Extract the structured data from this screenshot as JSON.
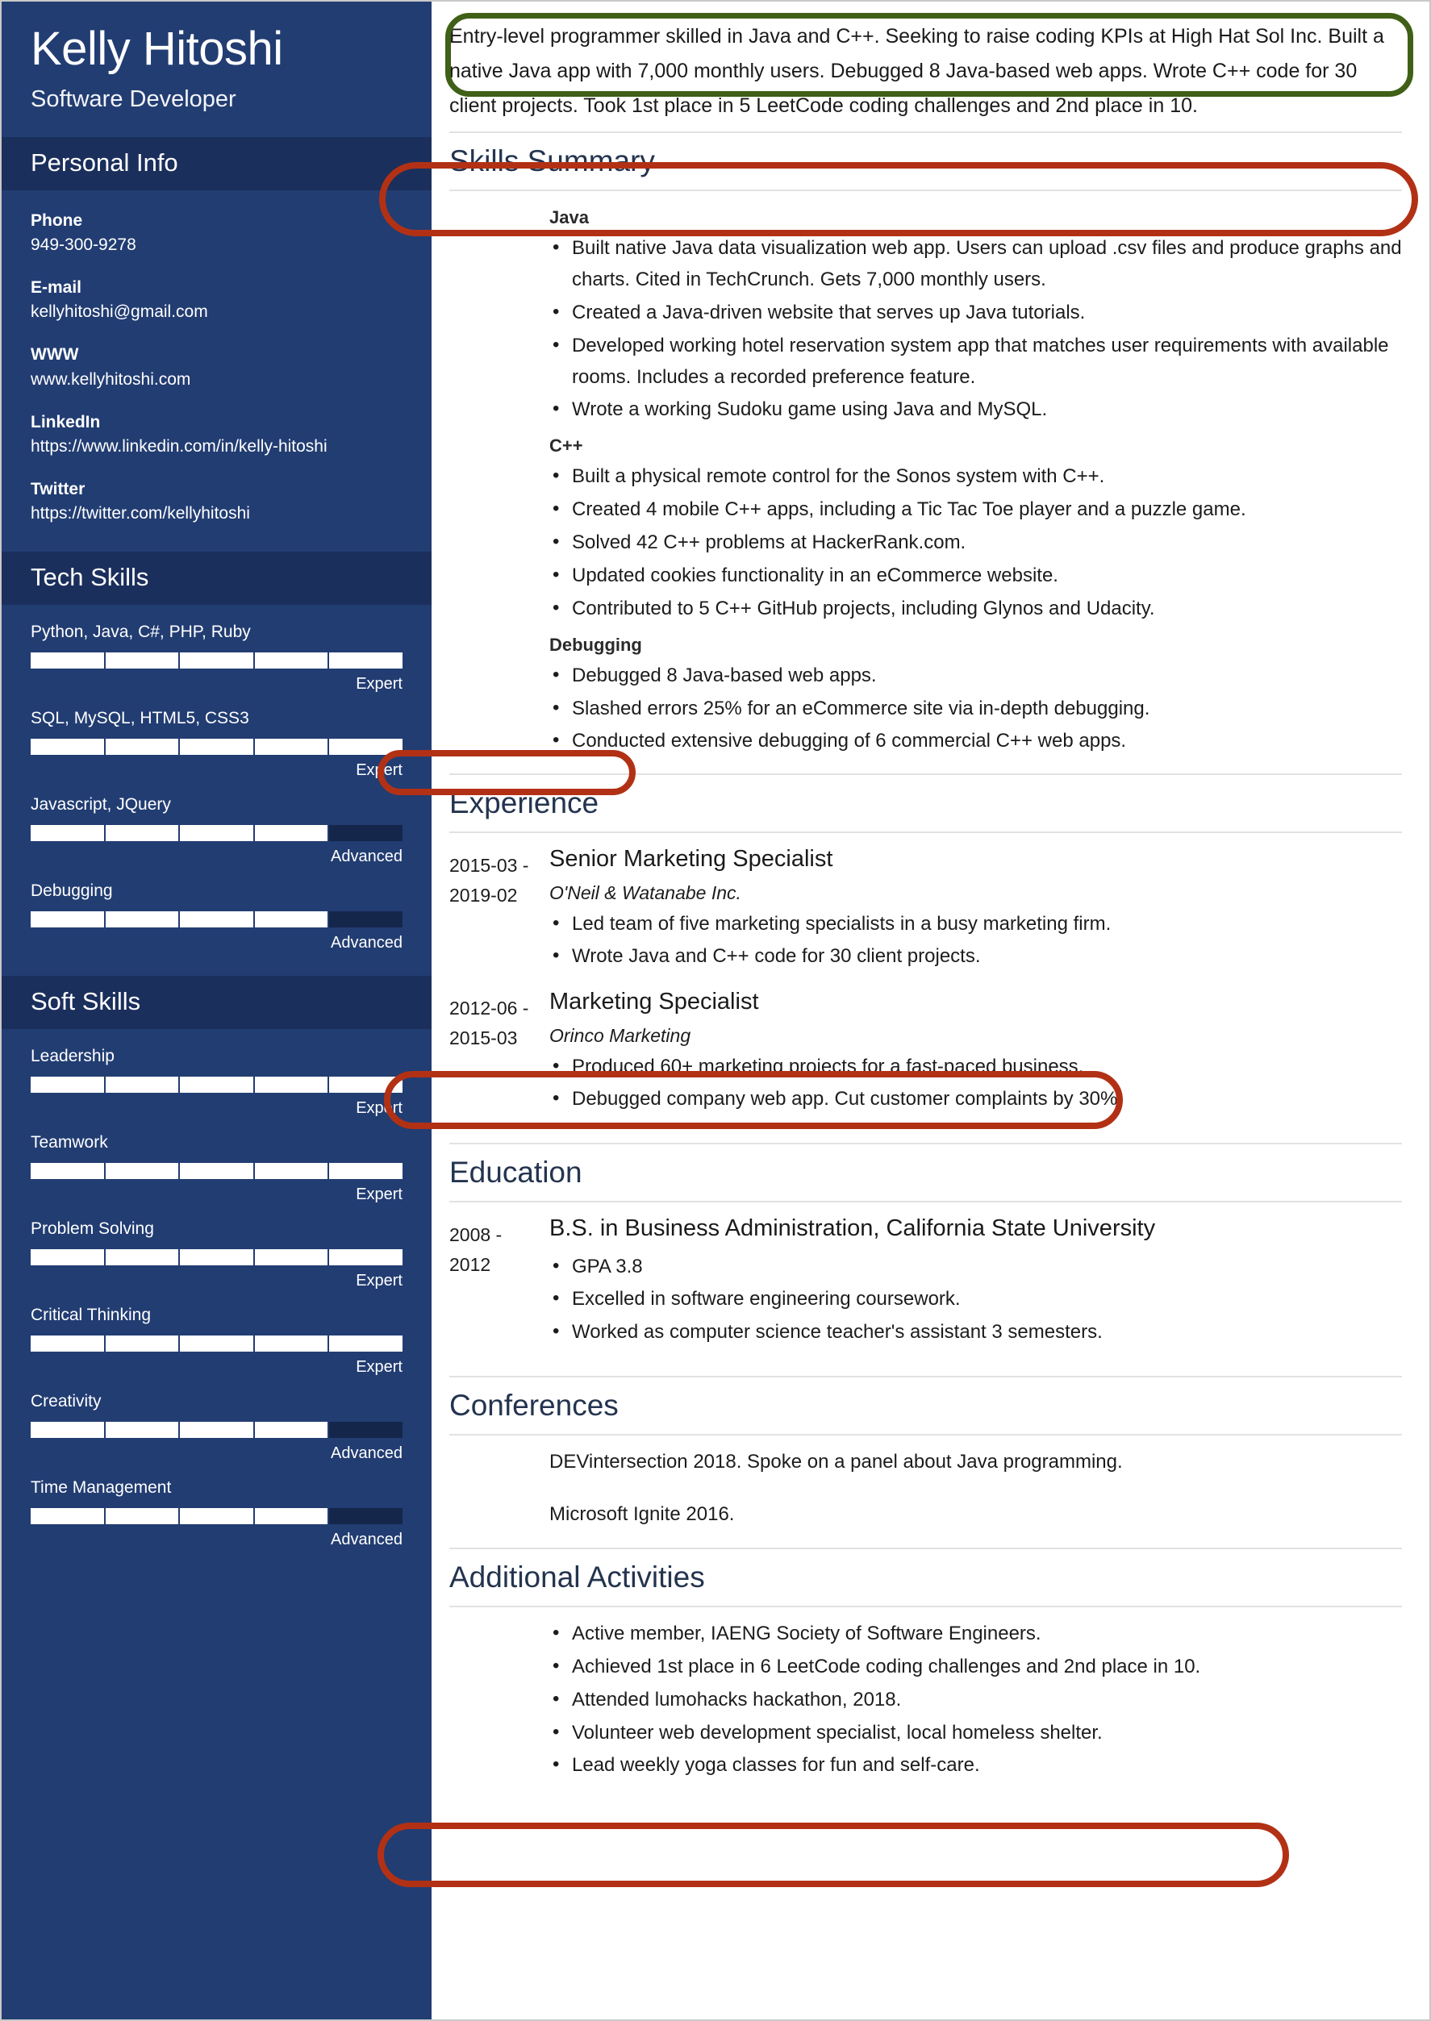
{
  "sidebar": {
    "name": "Kelly Hitoshi",
    "role": "Software Developer",
    "personal_info_title": "Personal Info",
    "contacts": [
      {
        "label": "Phone",
        "value": "949-300-9278"
      },
      {
        "label": "E-mail",
        "value": "kellyhitoshi@gmail.com"
      },
      {
        "label": "WWW",
        "value": "www.kellyhitoshi.com"
      },
      {
        "label": "LinkedIn",
        "value": "https://www.linkedin.com/in/kelly-hitoshi"
      },
      {
        "label": "Twitter",
        "value": "https://twitter.com/kellyhitoshi"
      }
    ],
    "tech_skills_title": "Tech Skills",
    "tech_skills": [
      {
        "name": "Python, Java, C#, PHP, Ruby",
        "level": "Expert",
        "filled": 5,
        "total": 5
      },
      {
        "name": "SQL, MySQL, HTML5, CSS3",
        "level": "Expert",
        "filled": 5,
        "total": 5
      },
      {
        "name": "Javascript, JQuery",
        "level": "Advanced",
        "filled": 4,
        "total": 5
      },
      {
        "name": "Debugging",
        "level": "Advanced",
        "filled": 4,
        "total": 5
      }
    ],
    "soft_skills_title": "Soft Skills",
    "soft_skills": [
      {
        "name": "Leadership",
        "level": "Expert",
        "filled": 5,
        "total": 5
      },
      {
        "name": "Teamwork",
        "level": "Expert",
        "filled": 5,
        "total": 5
      },
      {
        "name": "Problem Solving",
        "level": "Expert",
        "filled": 5,
        "total": 5
      },
      {
        "name": "Critical Thinking",
        "level": "Expert",
        "filled": 5,
        "total": 5
      },
      {
        "name": "Creativity",
        "level": "Advanced",
        "filled": 4,
        "total": 5
      },
      {
        "name": "Time Management",
        "level": "Advanced",
        "filled": 4,
        "total": 5
      }
    ]
  },
  "main": {
    "summary": "Entry-level programmer skilled in Java and C++. Seeking to raise coding KPIs at High Hat Sol Inc. Built a native Java app with 7,000 monthly users. Debugged 8 Java-based web apps. Wrote C++ code for 30 client projects. Took 1st place in 5 LeetCode coding challenges and 2nd place in 10.",
    "skills_summary": {
      "title": "Skills Summary",
      "groups": [
        {
          "heading": "Java",
          "items": [
            "Built native Java data visualization web app. Users can upload .csv files and produce graphs and charts. Cited in TechCrunch. Gets 7,000 monthly users.",
            "Created a Java-driven website that serves up Java tutorials.",
            "Developed working hotel reservation system app that matches user requirements with available rooms. Includes a recorded preference feature.",
            "Wrote a working Sudoku game using Java and MySQL."
          ]
        },
        {
          "heading": "C++",
          "items": [
            "Built a physical remote control for the Sonos system with C++.",
            "Created 4 mobile C++ apps, including a Tic Tac Toe player and a puzzle game.",
            "Solved 42 C++ problems at HackerRank.com.",
            "Updated cookies functionality in an eCommerce website.",
            "Contributed to 5 C++ GitHub projects, including Glynos and Udacity."
          ]
        },
        {
          "heading": "Debugging",
          "items": [
            "Debugged 8 Java-based web apps.",
            "Slashed errors 25% for an eCommerce site via in-depth debugging.",
            "Conducted extensive debugging of 6 commercial C++ web apps."
          ]
        }
      ]
    },
    "experience": {
      "title": "Experience",
      "entries": [
        {
          "dates": "2015-03 - 2019-02",
          "title": "Senior Marketing Specialist",
          "org": "O'Neil & Watanabe Inc.",
          "bullets": [
            "Led team of five marketing specialists in a busy marketing firm.",
            "Wrote Java and C++ code for 30 client projects."
          ]
        },
        {
          "dates": "2012-06 - 2015-03",
          "title": "Marketing Specialist",
          "org": "Orinco Marketing",
          "bullets": [
            "Produced 60+ marketing projects for a fast-paced business.",
            "Debugged company web app. Cut customer complaints by 30%."
          ]
        }
      ]
    },
    "education": {
      "title": "Education",
      "entries": [
        {
          "dates": "2008 - 2012",
          "title": "B.S. in Business Administration, California State University",
          "bullets": [
            "GPA 3.8",
            "Excelled in software engineering coursework.",
            "Worked as computer science teacher's assistant 3 semesters."
          ]
        }
      ]
    },
    "conferences": {
      "title": "Conferences",
      "items": [
        "DEVintersection 2018. Spoke on a panel about Java programming.",
        "Microsoft Ignite 2016."
      ]
    },
    "additional_activities": {
      "title": "Additional Activities",
      "items": [
        "Active member, IAENG Society of Software Engineers.",
        "Achieved 1st place in 6 LeetCode coding challenges and 2nd place in 10.",
        "Attended lumohacks hackathon, 2018.",
        "Volunteer web development specialist, local homeless shelter.",
        "Lead weekly yoga classes for fun and self-care."
      ]
    }
  },
  "annotations": {
    "green_color": "#3f6016",
    "red_color": "#b23115",
    "green_box_label": "summary-highlight",
    "red_oval_labels": [
      "java-first-bullet-highlight",
      "debugging-first-bullet-highlight",
      "experience-java-cpp-bullet-highlight",
      "leetcode-activity-highlight"
    ]
  },
  "theme": {
    "sidebar_bg": "#223d72",
    "sidebar_header_bg": "#1b2f5c",
    "bar_empty": "#15264b",
    "bar_fill": "#ffffff",
    "heading_color": "#24344f"
  }
}
